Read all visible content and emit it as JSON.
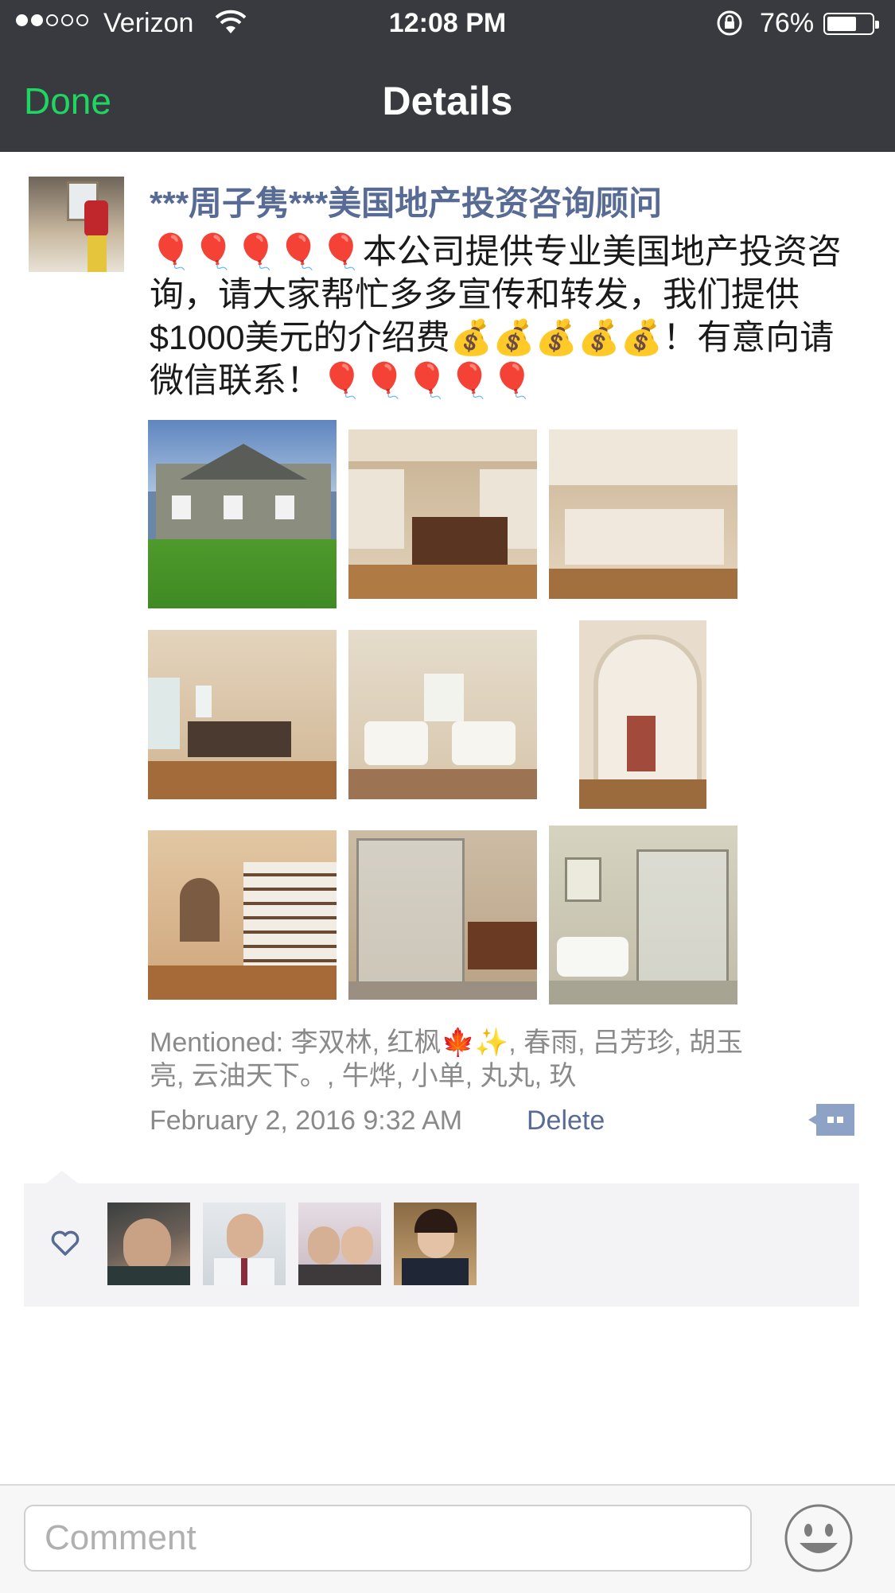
{
  "status_bar": {
    "carrier": "Verizon",
    "time": "12:08 PM",
    "battery": "76%",
    "battery_level": 0.76
  },
  "nav": {
    "done_label": "Done",
    "title": "Details"
  },
  "post": {
    "author": "***周子隽***美国地产投资咨询顾问",
    "text": "🎈🎈🎈🎈🎈本公司提供专业美国地产投资咨询，请大家帮忙多多宣传和转发，我们提供$1000美元的介绍费💰💰💰💰💰！有意向请微信联系！🎈🎈🎈🎈🎈",
    "photos": [
      "house-exterior",
      "kitchen-island",
      "kitchen-cabinets",
      "dining-room",
      "living-room",
      "entry-staircase-arch",
      "foyer-staircase",
      "bathroom-shower",
      "bathroom-tub"
    ],
    "mentioned": "Mentioned: 李双林, 红枫🍁✨, 春雨, 吕芳珍, 胡玉亮, 云油天下。, 牛烨, 小单, 丸丸, 玖",
    "date": "February 2, 2016 9:32 AM",
    "delete_label": "Delete"
  },
  "likes": {
    "icon": "heart-icon",
    "users": [
      "liker-1",
      "liker-2",
      "liker-3",
      "liker-4"
    ]
  },
  "comment": {
    "placeholder": "Comment",
    "emoji_icon": "smiley-icon"
  },
  "colors": {
    "nav_bg": "#393a3f",
    "done_green": "#1ed760",
    "link_blue": "#576b95",
    "likes_bg": "#f3f3f5"
  }
}
